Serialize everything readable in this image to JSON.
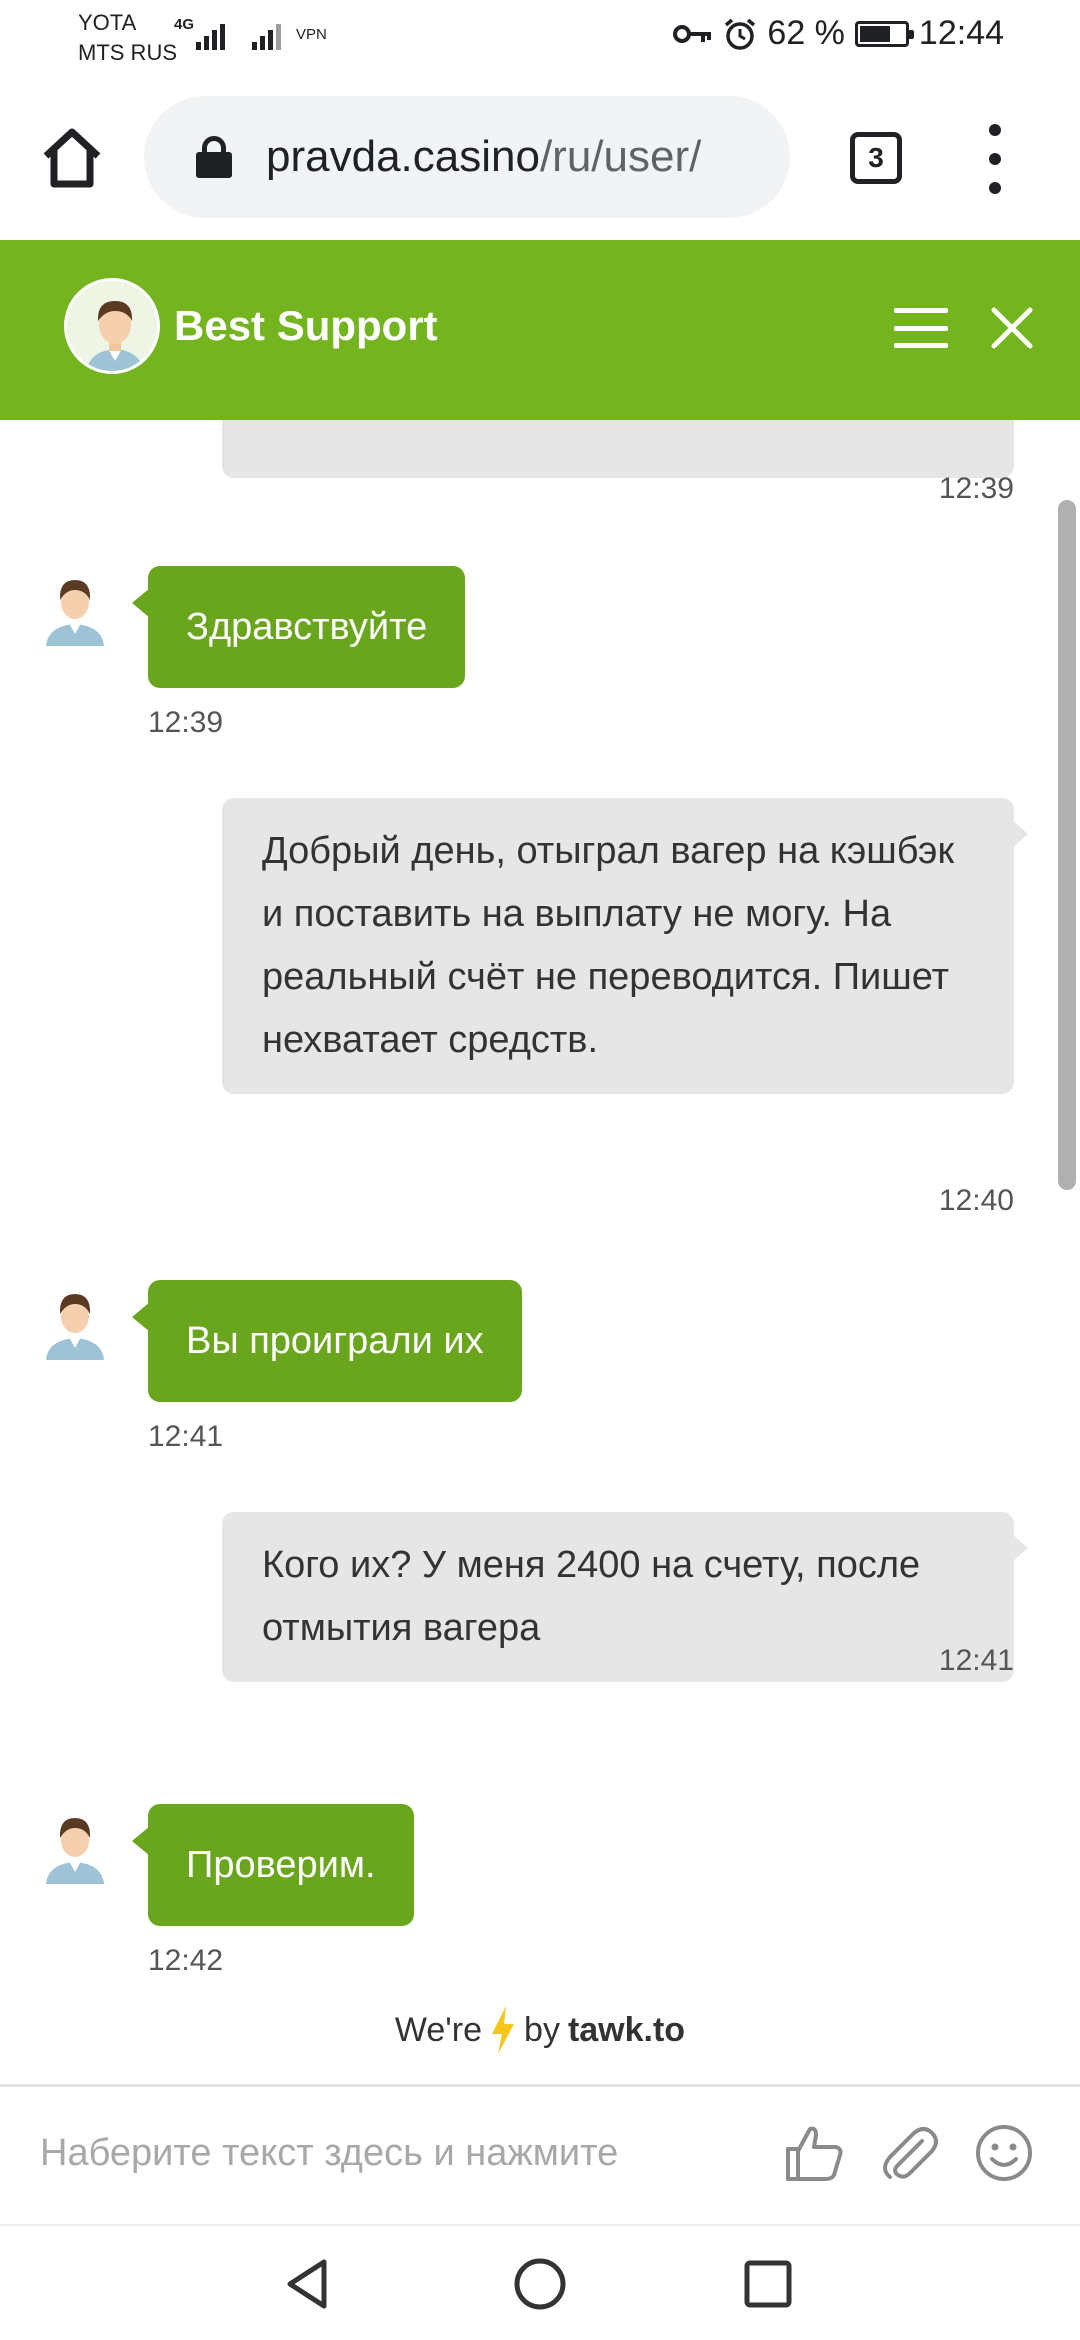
{
  "status_bar": {
    "carrier_1": "YOTA",
    "carrier_2": "MTS RUS",
    "network": "4G",
    "vpn": "VPN",
    "battery": "62 %",
    "time": "12:44",
    "icons": [
      "key-icon",
      "alarm-icon",
      "battery-icon",
      "signal-icon"
    ]
  },
  "browser": {
    "url_domain": "pravda.casino",
    "url_path": "/ru/user/",
    "tab_count": "3",
    "icons": [
      "home-icon",
      "lock-icon",
      "more-vert-icon"
    ]
  },
  "chat": {
    "agent_name": "Best Support",
    "accent_color": "#73b41f",
    "agent_bubble_color": "#6aa51e",
    "user_bubble_color": "#e6e6e6",
    "first_time": "12:39",
    "messages": [
      {
        "from": "agent",
        "text": "Здравствуйте",
        "time": "12:39"
      },
      {
        "from": "user",
        "text": "Добрый день, отыграл вагер на кэшбэк и поставить на выплату не могу. На реальный счёт не переводится. Пишет нехватает средств.",
        "time": "12:40"
      },
      {
        "from": "agent",
        "text": "Вы проиграли их",
        "time": "12:41"
      },
      {
        "from": "user",
        "text": "Кого их? У меня 2400 на счету, после отмытия вагера",
        "time": "12:41"
      },
      {
        "from": "agent",
        "text": "Проверим.",
        "time": "12:42"
      }
    ]
  },
  "powered": {
    "prefix": "We're",
    "by": "by",
    "brand": "tawk.to"
  },
  "input": {
    "placeholder": "Наберите текст здесь и нажмите",
    "icons": [
      "thumbs-up-icon",
      "paperclip-icon",
      "emoji-icon"
    ]
  },
  "nav": {
    "icons": [
      "back-icon",
      "home-circle-icon",
      "recents-icon"
    ]
  }
}
